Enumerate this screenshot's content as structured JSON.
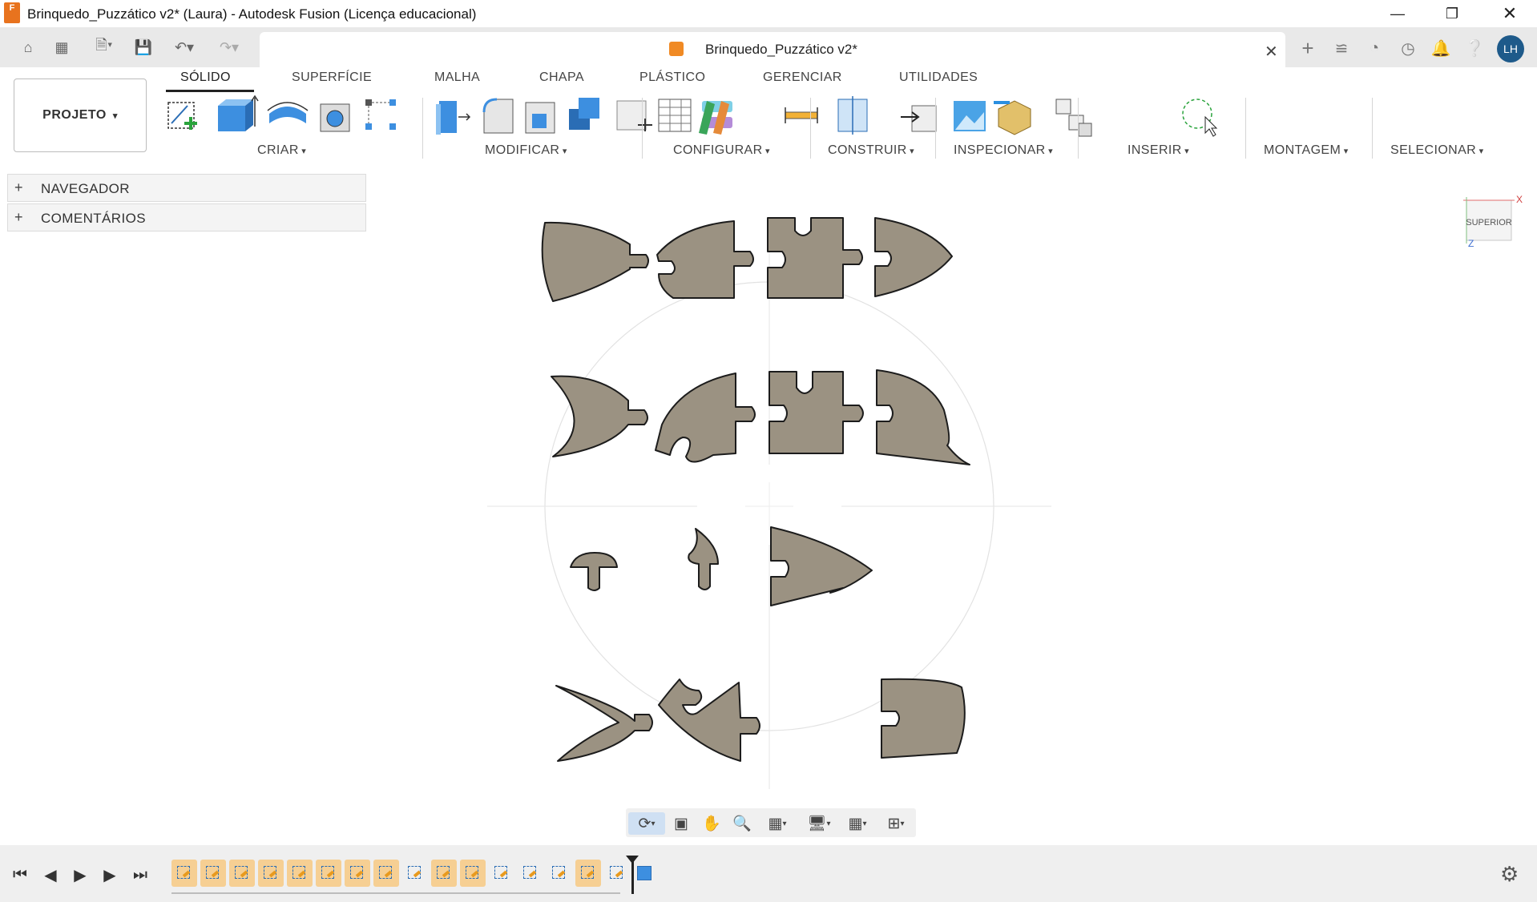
{
  "window": {
    "title": "Brinquedo_Puzzático v2* (Laura) - Autodesk Fusion (Licença educacional)",
    "app_icon_text": "F"
  },
  "document_tab": {
    "title": "Brinquedo_Puzzático v2*"
  },
  "user": {
    "initials": "LH"
  },
  "ribbon": {
    "workspace_button": "PROJETO",
    "tabs": [
      "SÓLIDO",
      "SUPERFÍCIE",
      "MALHA",
      "CHAPA",
      "PLÁSTICO",
      "GERENCIAR",
      "UTILIDADES"
    ],
    "active_tab": "SÓLIDO",
    "groups": [
      "CRIAR",
      "MODIFICAR",
      "CONFIGURAR",
      "CONSTRUIR",
      "INSPECIONAR",
      "INSERIR",
      "MONTAGEM",
      "SELECIONAR"
    ]
  },
  "browser": {
    "panels": [
      "NAVEGADOR",
      "COMENTÁRIOS"
    ]
  },
  "viewcube": {
    "face_label": "SUPERIOR",
    "axis_x": "X",
    "axis_z": "Z"
  },
  "colors": {
    "part_fill": "#9b9282",
    "part_stroke": "#1c1c1c",
    "timeline_highlight": "#f6cf93",
    "avatar": "#1e5a8a",
    "accent_blue": "#2a6db5"
  },
  "timeline": {
    "feature_count": 16,
    "highlighted_features": [
      0,
      1,
      2,
      3,
      4,
      5,
      6,
      7,
      9,
      10,
      14
    ]
  }
}
